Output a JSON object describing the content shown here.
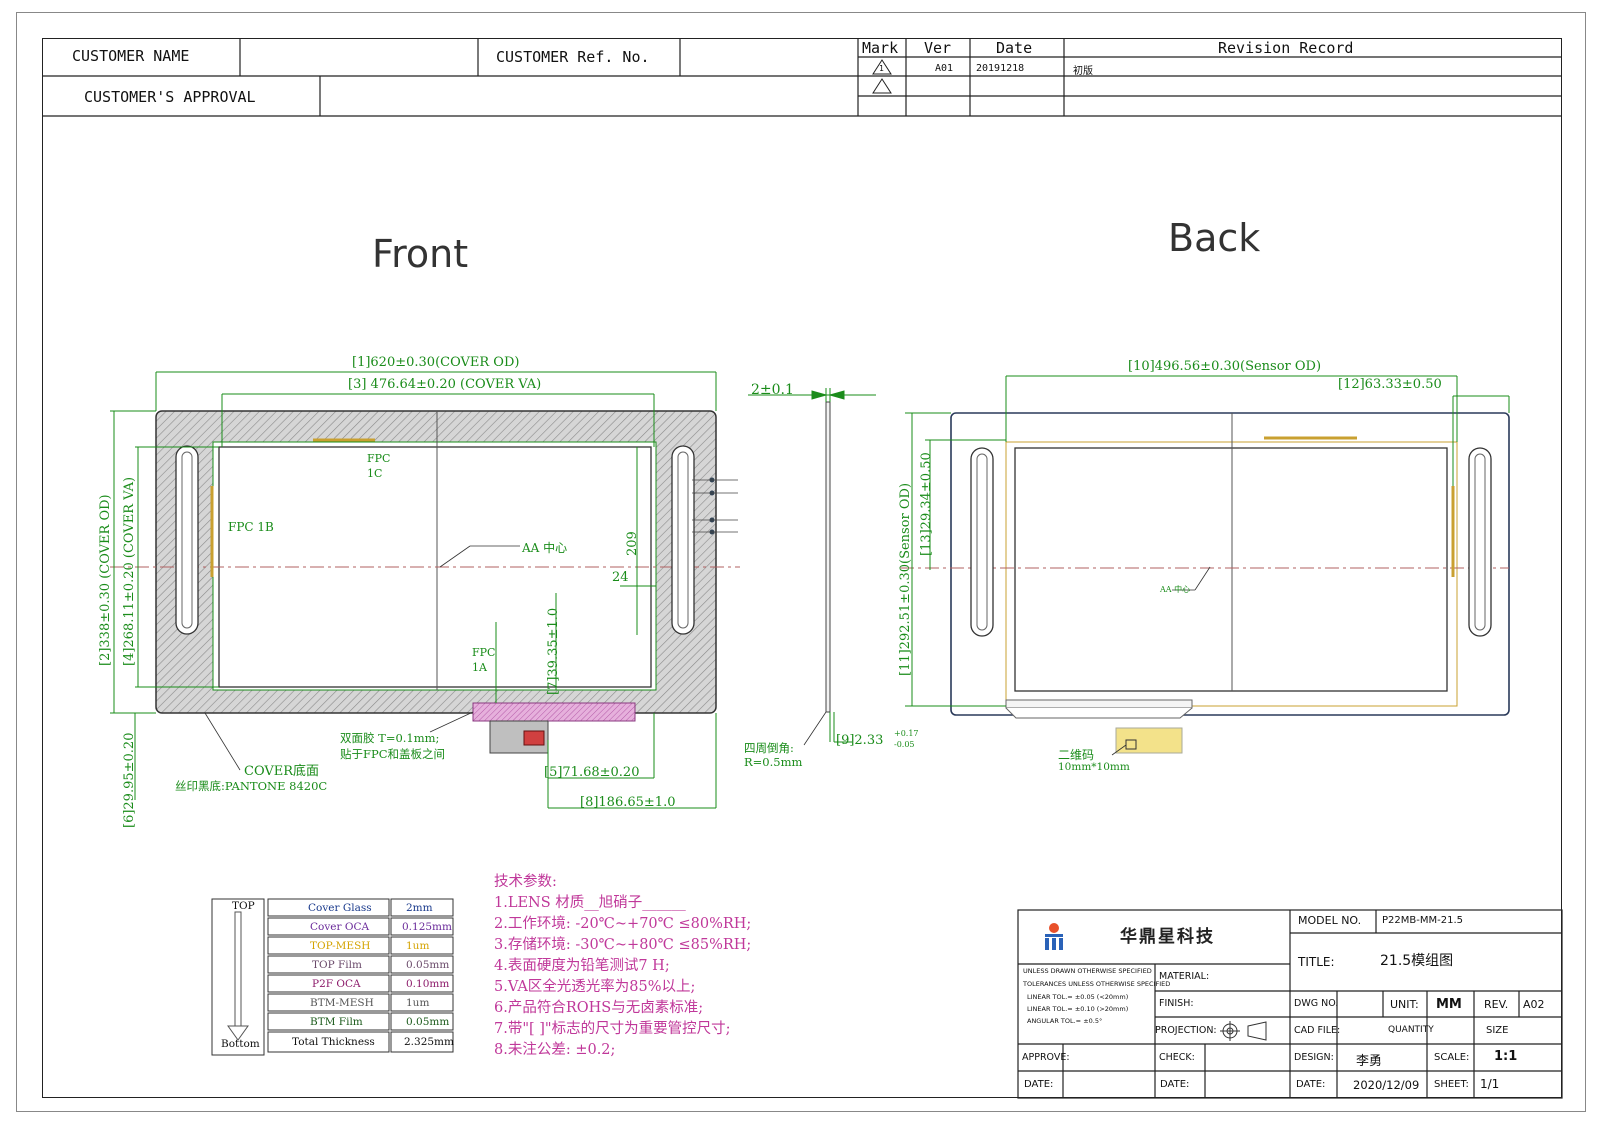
{
  "header": {
    "customer_name_label": "CUSTOMER NAME",
    "customer_ref_label": "CUSTOMER Ref. No.",
    "customer_approval_label": "CUSTOMER'S APPROVAL"
  },
  "revision": {
    "col_mark": "Mark",
    "col_ver": "Ver",
    "col_date": "Date",
    "col_record": "Revision Record",
    "row1_mark": "1",
    "row1_ver": "A01",
    "row1_date": "20191218",
    "row1_record": "初版"
  },
  "views": {
    "front_label": "Front",
    "back_label": "Back"
  },
  "front_dims": {
    "d1": "[1]620±0.30(COVER OD)",
    "d3": "[3] 476.64±0.20 (COVER VA)",
    "d2": "[2]338±0.30 (COVER OD)",
    "d4": "[4]268.11±0.20 (COVER VA)",
    "d6": "[6]29.95±0.20",
    "d7": "[7]39.35±1.0",
    "d5": "[5]71.68±0.20",
    "d8": "[8]186.65±1.0",
    "n209": "209",
    "n24": "24",
    "fpc1b": "FPC 1B",
    "fpc1c_a": "FPC",
    "fpc1c_b": "1C",
    "fpc1a_a": "FPC",
    "fpc1a_b": "1A",
    "aa_center": "AA 中心",
    "tape_a": "双面胶 T=0.1mm;",
    "tape_b": "贴于FPC和盖板之间",
    "cover_bottom": "COVER底面",
    "silk_print": "丝印黑底:PANTONE 8420C"
  },
  "side_dims": {
    "thickness": "2±0.1",
    "d9_main": "[9]2.33",
    "d9_plus": "+0.17",
    "d9_minus": "-0.05",
    "corner_a": "四周倒角:",
    "corner_b": "R=0.5mm"
  },
  "back_dims": {
    "d10": "[10]496.56±0.30(Sensor OD)",
    "d12": "[12]63.33±0.50",
    "d11": "[11]292.51±0.30(Sensor OD)",
    "d13": "[13]29.34±0.50",
    "aa_center": "AA 中心",
    "qr_a": "二维码",
    "qr_b": "10mm*10mm"
  },
  "stack": {
    "top_label": "TOP",
    "bottom_label": "Bottom",
    "rows": [
      {
        "name": "Cover Glass",
        "value": "2mm"
      },
      {
        "name": "Cover OCA",
        "value": "0.125mm"
      },
      {
        "name": "TOP-MESH",
        "value": "1um"
      },
      {
        "name": "TOP Film",
        "value": "0.05mm"
      },
      {
        "name": "P2F OCA",
        "value": "0.10mm"
      },
      {
        "name": "BTM-MESH",
        "value": "1um"
      },
      {
        "name": "BTM Film",
        "value": "0.05mm"
      },
      {
        "name": "Total Thickness",
        "value": "2.325mm"
      }
    ]
  },
  "tech": {
    "title": "技术参数:",
    "lines": [
      "1.LENS 材质__旭硝子______",
      "2.工作环境: -20℃~+70℃ ≤80%RH;",
      "3.存储环境: -30℃~+80℃ ≤85%RH;",
      "4.表面硬度为铅笔测试7 H;",
      "5.VA区全光透光率为85%以上;",
      "6.产品符合ROHS与无卤素标准;",
      "7.带\"[ ]\"标志的尺寸为重要管控尺寸;",
      "8.未注公差: ±0.2;"
    ]
  },
  "title_block": {
    "company": "华鼎星科技",
    "model_no_label": "MODEL NO.",
    "model_no": "P22MB-MM-21.5",
    "title_label": "TITLE:",
    "title": "21.5模组图",
    "tol_1": "UNLESS DRAWN OTHERWISE SPECIFIED",
    "tol_2": "TOLERANCES UNLESS OTHERWISE SPECIFIED",
    "tol_3": "LINEAR TOL.= ±0.05 (<20mm)",
    "tol_4": "LINEAR TOL.= ±0.10 (>20mm)",
    "tol_5": "ANGULAR TOL.= ±0.5°",
    "material_label": "MATERIAL:",
    "finish_label": "FINISH:",
    "projection_label": "PROJECTION:",
    "dwg_no_label": "DWG NO.",
    "unit_label": "UNIT:",
    "unit": "MM",
    "rev_label": "REV.",
    "rev": "A02",
    "cad_file_label": "CAD FILE:",
    "quantity_label": "QUANTITY",
    "size_label": "SIZE",
    "approve_label": "APPROVE:",
    "check_label": "CHECK:",
    "design_label": "DESIGN:",
    "designer": "李勇",
    "scale_label": "SCALE:",
    "scale": "1:1",
    "date_label_1": "DATE:",
    "date_label_2": "DATE:",
    "date_label_3": "DATE:",
    "date": "2020/12/09",
    "sheet_label": "SHEET:",
    "sheet": "1/1"
  }
}
